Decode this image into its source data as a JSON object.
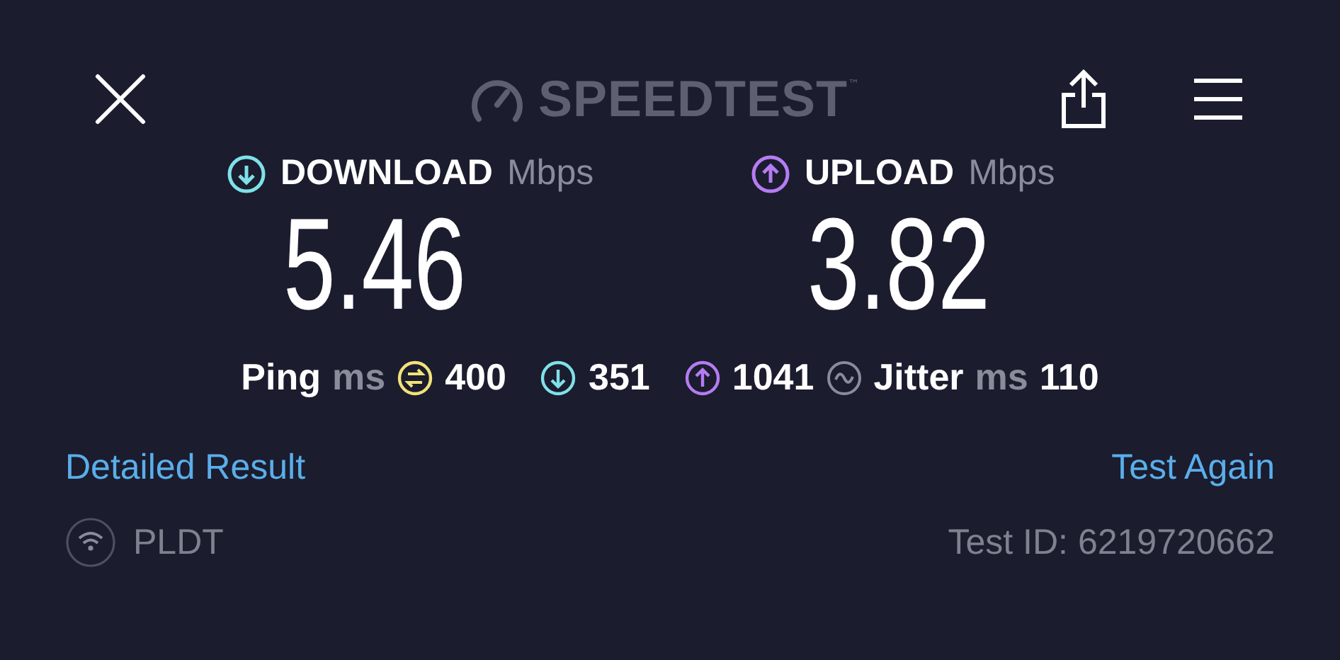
{
  "header": {
    "logo": "SPEEDTEST",
    "trademark": "™"
  },
  "results": [
    {
      "kind": "download",
      "label": "DOWNLOAD",
      "unit": "Mbps",
      "value": "5.46",
      "color": "#7fe1e8"
    },
    {
      "kind": "upload",
      "label": "UPLOAD",
      "unit": "Mbps",
      "value": "3.82",
      "color": "#b57cf2"
    }
  ],
  "ping": {
    "label": "Ping",
    "unit": "ms",
    "idle": "400",
    "download": "351",
    "upload": "1041"
  },
  "jitter": {
    "label": "Jitter",
    "unit": "ms",
    "value": "110"
  },
  "links": {
    "detailed": "Detailed Result",
    "again": "Test Again"
  },
  "footer": {
    "provider": "PLDT",
    "test_id": "Test ID: 6219720662"
  }
}
